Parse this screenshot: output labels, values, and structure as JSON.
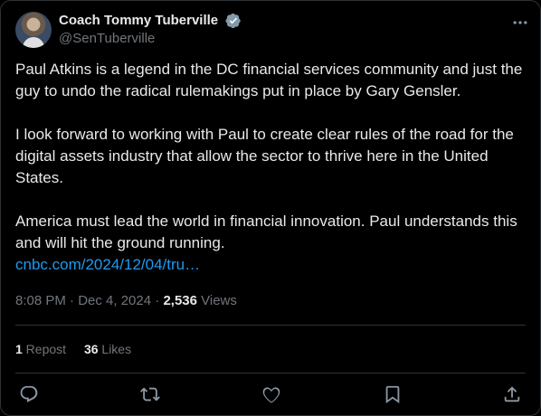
{
  "author": {
    "display_name": "Coach Tommy Tuberville",
    "handle": "@SenTuberville"
  },
  "tweet": {
    "paragraphs": [
      "Paul Atkins is a legend in the DC financial services community and just the guy to undo the radical rulemakings put in place by Gary Gensler.",
      "I look forward to working with Paul to create clear rules of the road for the digital assets industry that allow the sector to thrive here in the United States.",
      "America must lead the world in financial innovation. Paul understands this and will hit the ground running."
    ],
    "link_text": "cnbc.com/2024/12/04/tru…",
    "timestamp": "8:08 PM · Dec 4, 2024",
    "separator": " · ",
    "views_count": "2,536",
    "views_label": " Views"
  },
  "stats": {
    "reposts_count": "1",
    "reposts_label": " Repost",
    "likes_count": "36",
    "likes_label": " Likes"
  },
  "icons": {
    "verified": "verified-badge-icon",
    "more": "more-options-icon",
    "reply": "reply-icon",
    "repost": "repost-icon",
    "like": "heart-icon",
    "bookmark": "bookmark-icon",
    "share": "share-icon"
  },
  "colors": {
    "background": "#000000",
    "text": "#e7e9ea",
    "secondary": "#71767b",
    "link": "#1d9bf0",
    "verified_badge": "#829aab",
    "border": "#2f3336"
  }
}
